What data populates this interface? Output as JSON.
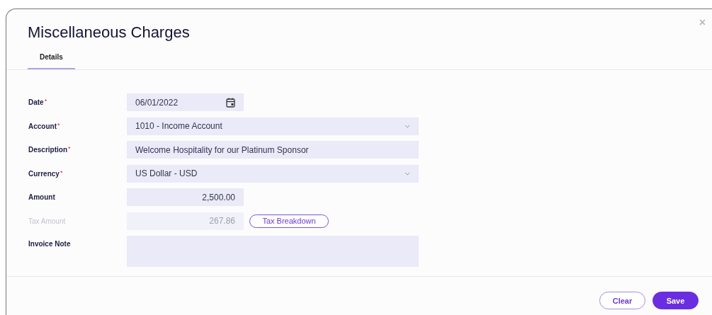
{
  "dialog": {
    "title": "Miscellaneous Charges",
    "close": "×"
  },
  "tabs": [
    {
      "label": "Details",
      "selected": true
    }
  ],
  "fields": [
    {
      "label": "Date",
      "required_mark": "*",
      "kind": "date",
      "value": "06/01/2022",
      "disabled": false
    },
    {
      "label": "Account",
      "required_mark": "*",
      "kind": "select",
      "value": "1010 - Income Account",
      "disabled": false
    },
    {
      "label": "Description",
      "required_mark": "*",
      "kind": "text",
      "value": "Welcome Hospitality for our Platinum Sponsor",
      "disabled": false
    },
    {
      "label": "Currency",
      "required_mark": "*",
      "kind": "select",
      "value": "US Dollar - USD",
      "disabled": false
    },
    {
      "label": "Amount",
      "kind": "amount",
      "value": "2,500.00",
      "disabled": false
    },
    {
      "label": "Tax Amount",
      "kind": "amount",
      "value": "267.86",
      "disabled": true,
      "button": "Tax Breakdown"
    },
    {
      "label": "Invoice Note",
      "kind": "textarea",
      "disabled": false
    }
  ],
  "buttons": [
    {
      "label": "Clear",
      "kind": "secondary"
    },
    {
      "label": "Save",
      "kind": "primary"
    }
  ]
}
